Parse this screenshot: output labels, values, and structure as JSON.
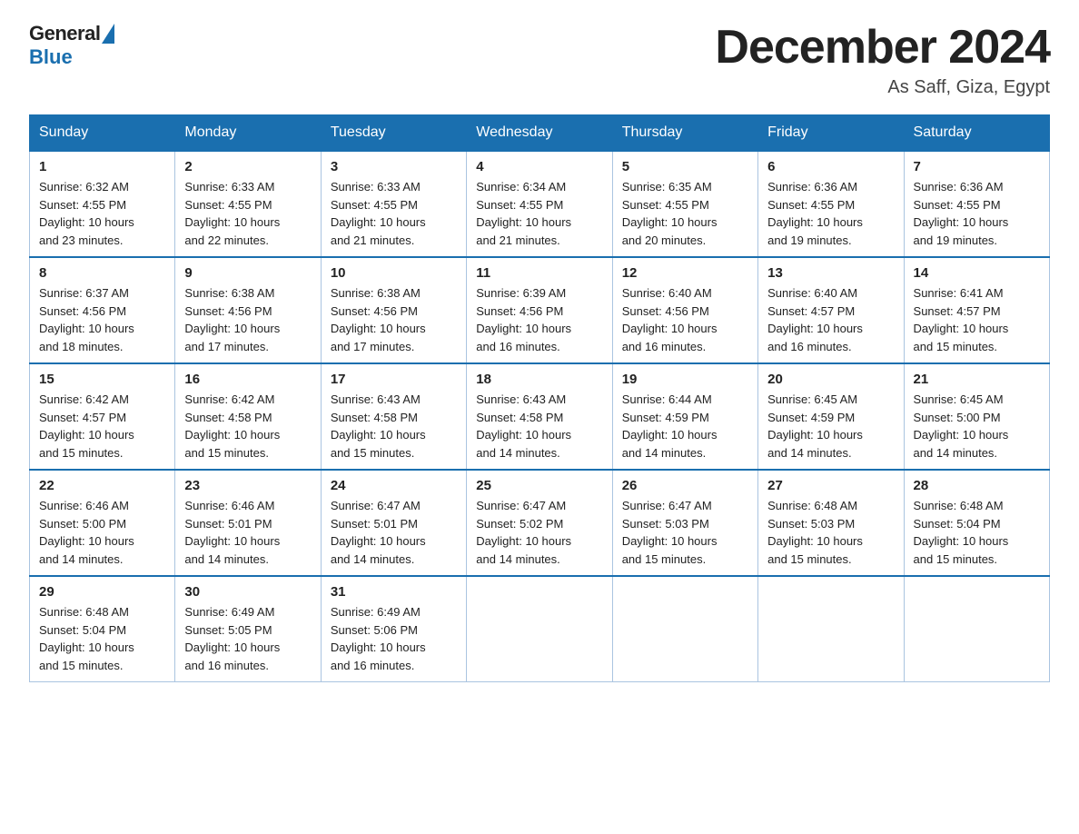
{
  "logo": {
    "text_general": "General",
    "text_blue": "Blue"
  },
  "header": {
    "month": "December 2024",
    "location": "As Saff, Giza, Egypt"
  },
  "days_of_week": [
    "Sunday",
    "Monday",
    "Tuesday",
    "Wednesday",
    "Thursday",
    "Friday",
    "Saturday"
  ],
  "weeks": [
    [
      {
        "day": "1",
        "sunrise": "6:32 AM",
        "sunset": "4:55 PM",
        "daylight": "10 hours and 23 minutes."
      },
      {
        "day": "2",
        "sunrise": "6:33 AM",
        "sunset": "4:55 PM",
        "daylight": "10 hours and 22 minutes."
      },
      {
        "day": "3",
        "sunrise": "6:33 AM",
        "sunset": "4:55 PM",
        "daylight": "10 hours and 21 minutes."
      },
      {
        "day": "4",
        "sunrise": "6:34 AM",
        "sunset": "4:55 PM",
        "daylight": "10 hours and 21 minutes."
      },
      {
        "day": "5",
        "sunrise": "6:35 AM",
        "sunset": "4:55 PM",
        "daylight": "10 hours and 20 minutes."
      },
      {
        "day": "6",
        "sunrise": "6:36 AM",
        "sunset": "4:55 PM",
        "daylight": "10 hours and 19 minutes."
      },
      {
        "day": "7",
        "sunrise": "6:36 AM",
        "sunset": "4:55 PM",
        "daylight": "10 hours and 19 minutes."
      }
    ],
    [
      {
        "day": "8",
        "sunrise": "6:37 AM",
        "sunset": "4:56 PM",
        "daylight": "10 hours and 18 minutes."
      },
      {
        "day": "9",
        "sunrise": "6:38 AM",
        "sunset": "4:56 PM",
        "daylight": "10 hours and 17 minutes."
      },
      {
        "day": "10",
        "sunrise": "6:38 AM",
        "sunset": "4:56 PM",
        "daylight": "10 hours and 17 minutes."
      },
      {
        "day": "11",
        "sunrise": "6:39 AM",
        "sunset": "4:56 PM",
        "daylight": "10 hours and 16 minutes."
      },
      {
        "day": "12",
        "sunrise": "6:40 AM",
        "sunset": "4:56 PM",
        "daylight": "10 hours and 16 minutes."
      },
      {
        "day": "13",
        "sunrise": "6:40 AM",
        "sunset": "4:57 PM",
        "daylight": "10 hours and 16 minutes."
      },
      {
        "day": "14",
        "sunrise": "6:41 AM",
        "sunset": "4:57 PM",
        "daylight": "10 hours and 15 minutes."
      }
    ],
    [
      {
        "day": "15",
        "sunrise": "6:42 AM",
        "sunset": "4:57 PM",
        "daylight": "10 hours and 15 minutes."
      },
      {
        "day": "16",
        "sunrise": "6:42 AM",
        "sunset": "4:58 PM",
        "daylight": "10 hours and 15 minutes."
      },
      {
        "day": "17",
        "sunrise": "6:43 AM",
        "sunset": "4:58 PM",
        "daylight": "10 hours and 15 minutes."
      },
      {
        "day": "18",
        "sunrise": "6:43 AM",
        "sunset": "4:58 PM",
        "daylight": "10 hours and 14 minutes."
      },
      {
        "day": "19",
        "sunrise": "6:44 AM",
        "sunset": "4:59 PM",
        "daylight": "10 hours and 14 minutes."
      },
      {
        "day": "20",
        "sunrise": "6:45 AM",
        "sunset": "4:59 PM",
        "daylight": "10 hours and 14 minutes."
      },
      {
        "day": "21",
        "sunrise": "6:45 AM",
        "sunset": "5:00 PM",
        "daylight": "10 hours and 14 minutes."
      }
    ],
    [
      {
        "day": "22",
        "sunrise": "6:46 AM",
        "sunset": "5:00 PM",
        "daylight": "10 hours and 14 minutes."
      },
      {
        "day": "23",
        "sunrise": "6:46 AM",
        "sunset": "5:01 PM",
        "daylight": "10 hours and 14 minutes."
      },
      {
        "day": "24",
        "sunrise": "6:47 AM",
        "sunset": "5:01 PM",
        "daylight": "10 hours and 14 minutes."
      },
      {
        "day": "25",
        "sunrise": "6:47 AM",
        "sunset": "5:02 PM",
        "daylight": "10 hours and 14 minutes."
      },
      {
        "day": "26",
        "sunrise": "6:47 AM",
        "sunset": "5:03 PM",
        "daylight": "10 hours and 15 minutes."
      },
      {
        "day": "27",
        "sunrise": "6:48 AM",
        "sunset": "5:03 PM",
        "daylight": "10 hours and 15 minutes."
      },
      {
        "day": "28",
        "sunrise": "6:48 AM",
        "sunset": "5:04 PM",
        "daylight": "10 hours and 15 minutes."
      }
    ],
    [
      {
        "day": "29",
        "sunrise": "6:48 AM",
        "sunset": "5:04 PM",
        "daylight": "10 hours and 15 minutes."
      },
      {
        "day": "30",
        "sunrise": "6:49 AM",
        "sunset": "5:05 PM",
        "daylight": "10 hours and 16 minutes."
      },
      {
        "day": "31",
        "sunrise": "6:49 AM",
        "sunset": "5:06 PM",
        "daylight": "10 hours and 16 minutes."
      },
      null,
      null,
      null,
      null
    ]
  ],
  "labels": {
    "sunrise": "Sunrise:",
    "sunset": "Sunset:",
    "daylight": "Daylight:"
  }
}
